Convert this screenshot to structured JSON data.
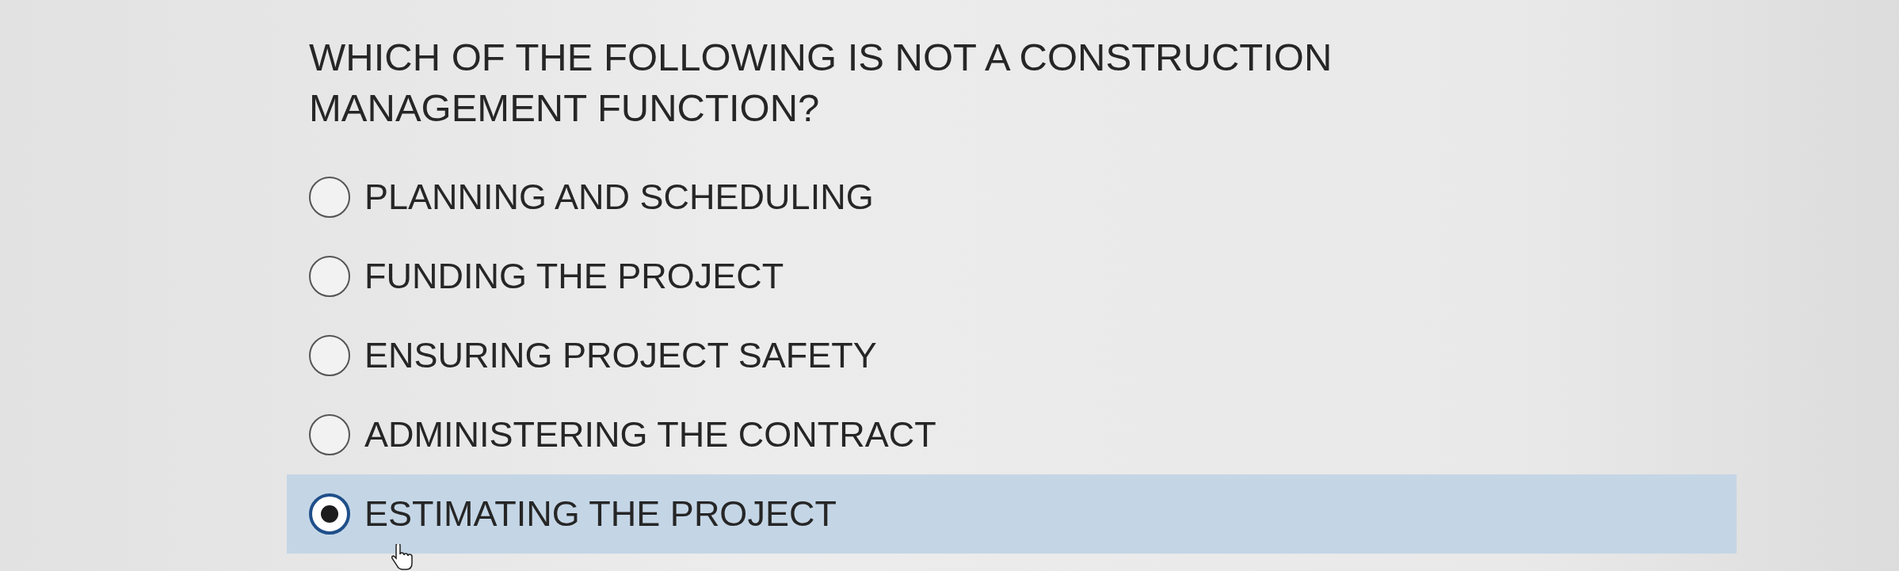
{
  "question": "WHICH OF THE FOLLOWING IS NOT A CONSTRUCTION MANAGEMENT FUNCTION?",
  "options": [
    {
      "label": "PLANNING AND SCHEDULING",
      "selected": false
    },
    {
      "label": "FUNDING THE PROJECT",
      "selected": false
    },
    {
      "label": "ENSURING PROJECT SAFETY",
      "selected": false
    },
    {
      "label": "ADMINISTERING THE CONTRACT",
      "selected": false
    },
    {
      "label": "ESTIMATING THE PROJECT",
      "selected": true
    }
  ]
}
